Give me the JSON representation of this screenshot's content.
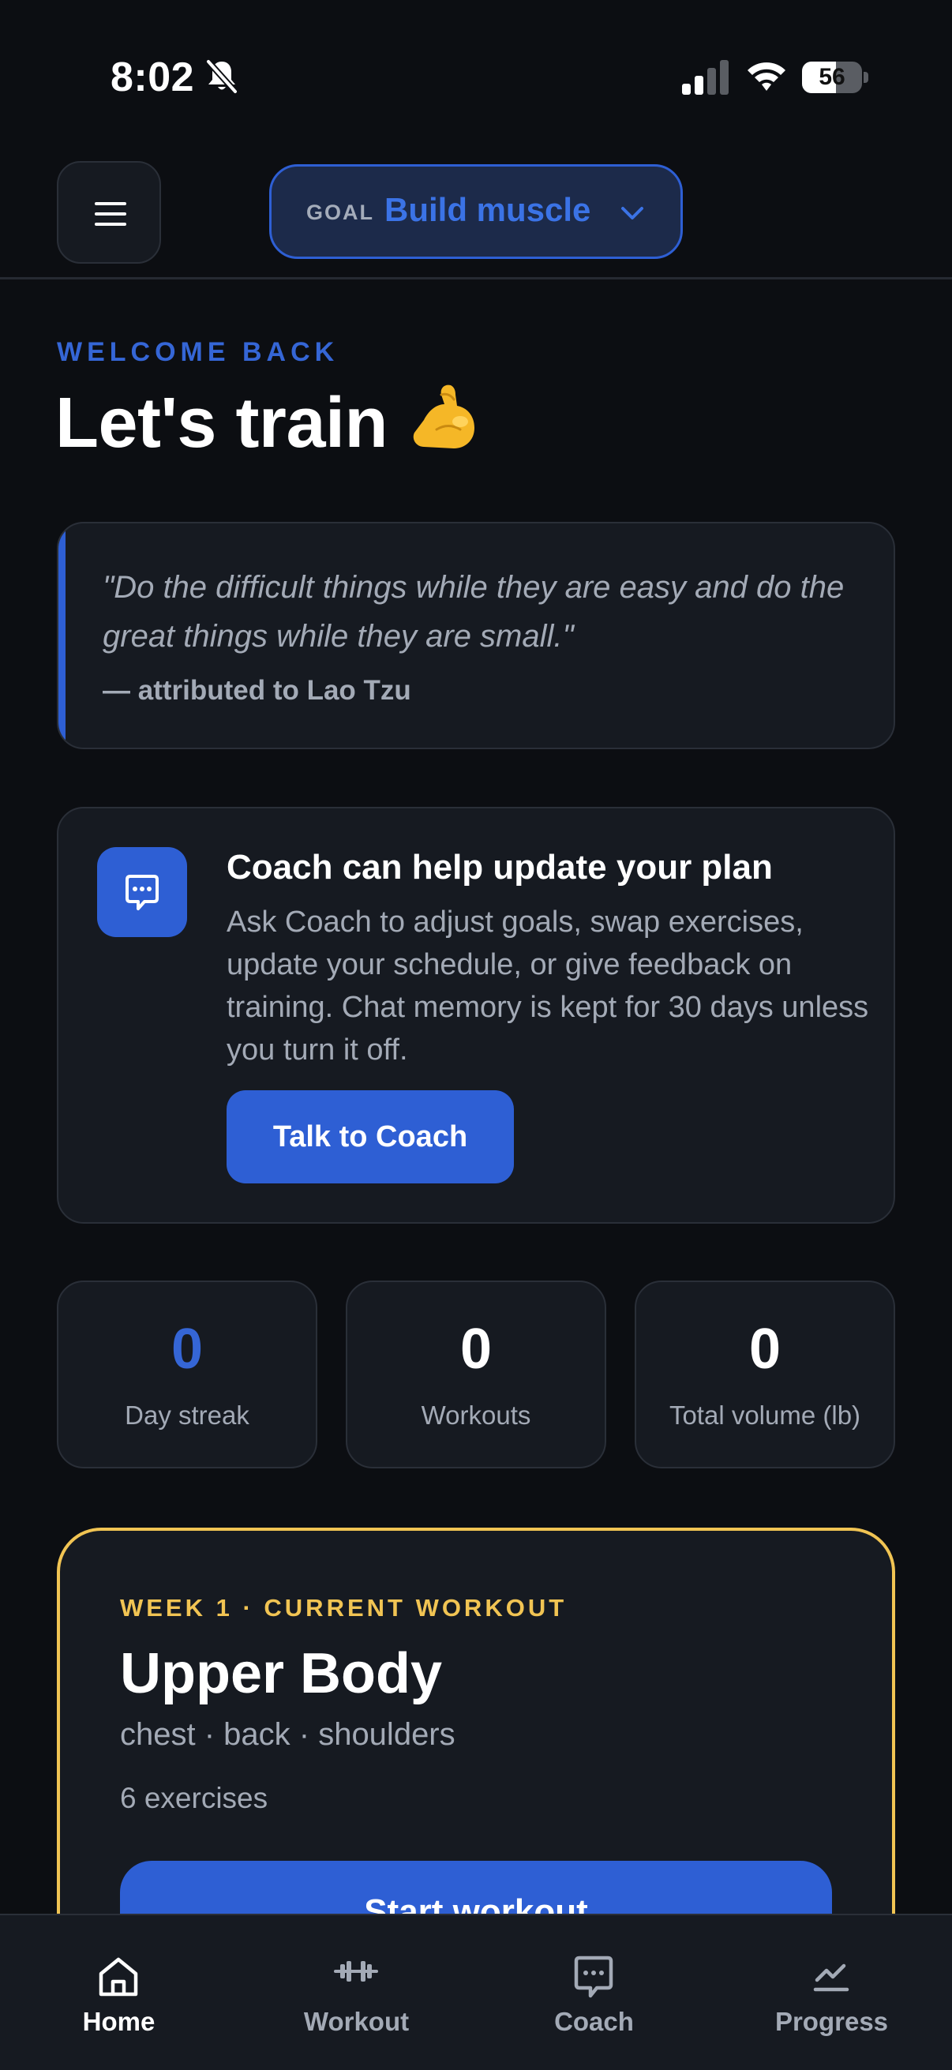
{
  "status_bar": {
    "time": "8:02",
    "battery_level": "56",
    "battery_fraction": 0.56
  },
  "header": {
    "goal_label": "GOAL",
    "goal_value": "Build muscle"
  },
  "welcome": {
    "eyebrow": "WELCOME BACK",
    "title": "Let's train"
  },
  "quote": {
    "text": "\"Do the difficult things while they are easy and do the great things while they are small.\"",
    "author": "— attributed to Lao Tzu"
  },
  "coach_card": {
    "title": "Coach can help update your plan",
    "body": "Ask Coach to adjust goals, swap exercises, update your schedule, or give feedback on training. Chat memory is kept for 30 days unless you turn it off.",
    "button_label": "Talk to Coach"
  },
  "stats": [
    {
      "value": "0",
      "label": "Day streak"
    },
    {
      "value": "0",
      "label": "Workouts"
    },
    {
      "value": "0",
      "label": "Total volume (lb)"
    }
  ],
  "workout": {
    "eyebrow": "WEEK 1 · CURRENT WORKOUT",
    "title": "Upper Body",
    "muscles": "chest · back · shoulders",
    "exercise_count": "6 exercises",
    "button_label": "Start workout"
  },
  "tabs": [
    {
      "label": "Home",
      "icon": "home-icon",
      "active": true
    },
    {
      "label": "Workout",
      "icon": "dumbbell-icon",
      "active": false
    },
    {
      "label": "Coach",
      "icon": "chat-icon",
      "active": false
    },
    {
      "label": "Progress",
      "icon": "chart-icon",
      "active": false
    }
  ],
  "colors": {
    "background": "#0c0e12",
    "card": "#161a21",
    "accent_blue": "#2e5fd4",
    "accent_gold": "#f1c453"
  }
}
